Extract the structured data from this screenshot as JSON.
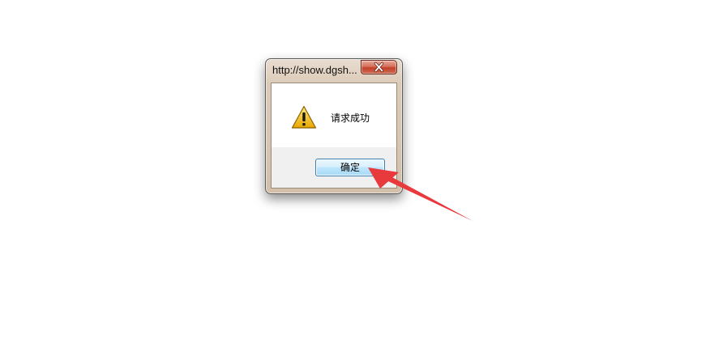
{
  "dialog": {
    "title": "http://show.dgsh...",
    "message": "请求成功",
    "ok_label": "确定",
    "icons": {
      "close": "close-icon",
      "message": "warning-icon"
    }
  },
  "annotation": {
    "type": "arrow",
    "color": "#e8393d"
  }
}
